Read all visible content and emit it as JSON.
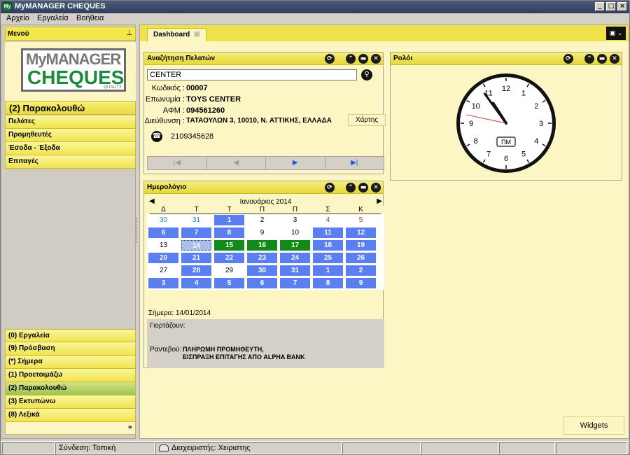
{
  "app": {
    "title": "MyMANAGER CHEQUES",
    "icon_label": "My",
    "window_buttons": [
      "_",
      "□",
      "×"
    ]
  },
  "menubar": {
    "items": [
      "Αρχείο",
      "Εργαλεία",
      "Βοήθεια"
    ]
  },
  "sidebar": {
    "header": "Μενού",
    "logo": {
      "line1": "MyMANAGER",
      "line2": "CHEQUES",
      "sub": "QUALITY"
    },
    "section_title": "(2) Παρακολουθώ",
    "nav_items": [
      "Πελάτες",
      "Προμηθευτές",
      "Έσοδα - Έξοδα",
      "Επιταγές"
    ],
    "bottom_items": [
      "(0) Εργαλεία",
      "(9) Πρόσβαση",
      "(*) Σήμερα",
      "(1) Προετοιμάζω",
      "(2) Παρακολουθώ",
      "(3) Εκτυπώνω",
      "(8) Λεξικά"
    ],
    "bottom_active_index": 4,
    "expand_glyph": "»"
  },
  "main": {
    "tab_label": "Dashboard",
    "tab_close_glyph": "⊠"
  },
  "search_panel": {
    "title": "Αναζήτηση Πελατών",
    "query": "CENTER",
    "fields": {
      "code_label": "Κωδικός :",
      "code_value": "00007",
      "name_label": "Επωνυμία :",
      "name_value": "TOYS CENTER",
      "afm_label": "ΑΦΜ :",
      "afm_value": "094561260",
      "address_label": "Διεύθυνση :",
      "address_value": "ΤΑΤΑΟΥΛΩΝ 3, 10010, Ν. ΑΤΤΙΚΗΣ, ΕΛΛΑΔΑ",
      "phone_value": "2109345628"
    },
    "map_button": "Χάρτης",
    "nav_buttons": [
      "|◀",
      "◀",
      "▶",
      "▶|"
    ]
  },
  "calendar_panel": {
    "title": "Ημερολόγιο",
    "month_title": "Ιανουάριος 2014",
    "prev_glyph": "◀",
    "next_glyph": "▶",
    "weekdays": [
      "Δ",
      "Τ",
      "Τ",
      "Π",
      "Π",
      "Σ",
      "Κ"
    ],
    "weeks": [
      [
        {
          "d": "30",
          "s": "teal"
        },
        {
          "d": "31",
          "s": "teal"
        },
        {
          "d": "1",
          "s": "blue"
        },
        {
          "d": "2",
          "s": "plain"
        },
        {
          "d": "3",
          "s": "plain"
        },
        {
          "d": "4",
          "s": "red"
        },
        {
          "d": "5",
          "s": "red"
        }
      ],
      [
        {
          "d": "6",
          "s": "blue"
        },
        {
          "d": "7",
          "s": "blue"
        },
        {
          "d": "8",
          "s": "blue"
        },
        {
          "d": "9",
          "s": "plain"
        },
        {
          "d": "10",
          "s": "plain"
        },
        {
          "d": "11",
          "s": "blue"
        },
        {
          "d": "12",
          "s": "blue"
        }
      ],
      [
        {
          "d": "13",
          "s": "plain"
        },
        {
          "d": "14",
          "s": "today"
        },
        {
          "d": "15",
          "s": "green"
        },
        {
          "d": "16",
          "s": "green"
        },
        {
          "d": "17",
          "s": "green"
        },
        {
          "d": "18",
          "s": "blue"
        },
        {
          "d": "19",
          "s": "blue"
        }
      ],
      [
        {
          "d": "20",
          "s": "blue"
        },
        {
          "d": "21",
          "s": "blue"
        },
        {
          "d": "22",
          "s": "blue"
        },
        {
          "d": "23",
          "s": "blue"
        },
        {
          "d": "24",
          "s": "blue"
        },
        {
          "d": "25",
          "s": "blue"
        },
        {
          "d": "26",
          "s": "blue"
        }
      ],
      [
        {
          "d": "27",
          "s": "plain"
        },
        {
          "d": "28",
          "s": "blue"
        },
        {
          "d": "29",
          "s": "plain"
        },
        {
          "d": "30",
          "s": "blue"
        },
        {
          "d": "31",
          "s": "blue"
        },
        {
          "d": "1",
          "s": "blue"
        },
        {
          "d": "2",
          "s": "blue"
        }
      ],
      [
        {
          "d": "3",
          "s": "blue"
        },
        {
          "d": "4",
          "s": "blue"
        },
        {
          "d": "5",
          "s": "blue"
        },
        {
          "d": "6",
          "s": "blue"
        },
        {
          "d": "7",
          "s": "blue"
        },
        {
          "d": "8",
          "s": "blue"
        },
        {
          "d": "9",
          "s": "blue"
        }
      ]
    ],
    "today_text": "Σήμερα: 14/01/2014",
    "namedays_label": "Γιορτάζουν:",
    "appointments_label": "Ραντεβού:",
    "appointments": [
      "ΠΛΗΡΩΜΗ ΠΡΟΜΗΘΕΥΤΗ,",
      "ΕΙΣΠΡΑΞΗ ΕΠΙΤΑΓΗΣ ΑΠΟ ALPHA BANK"
    ]
  },
  "clock_panel": {
    "title": "Ρολόι",
    "ampm": "ΠΜ",
    "time": {
      "hour": 10,
      "minute": 54,
      "second": 47
    },
    "numerals": [
      "12",
      "1",
      "2",
      "3",
      "4",
      "5",
      "6",
      "7",
      "8",
      "9",
      "10",
      "11"
    ]
  },
  "panel_icons": [
    "refresh-icon",
    "collapse-icon",
    "minimize-icon",
    "close-icon"
  ],
  "widgets_button": "Widgets",
  "statusbar": {
    "connection": "Σύνδεση: Τοπική",
    "manager": "Διαχειριστής: Χειριστης"
  },
  "colors": {
    "accent_yellow": "#f3e84a",
    "panel_bg": "#fbf6c4",
    "calendar_blue": "#5b7ff0",
    "calendar_green": "#118a1a",
    "logo_green": "#1b8a3e"
  }
}
